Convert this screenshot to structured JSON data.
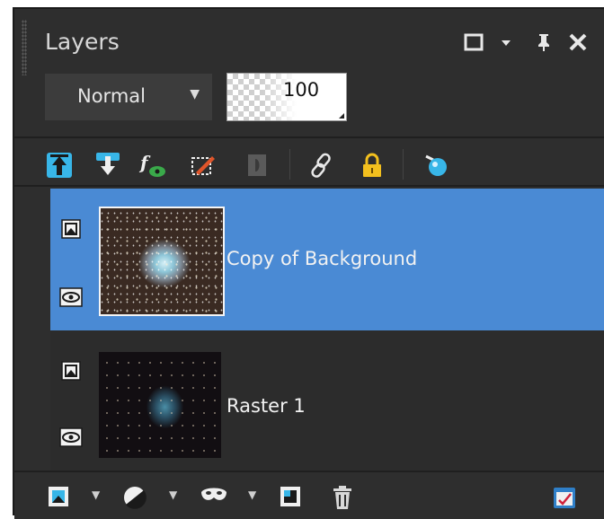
{
  "panel": {
    "title": "Layers",
    "window_buttons": [
      "maximize-icon",
      "menu-chevron-icon",
      "pin-icon",
      "close-icon"
    ]
  },
  "blend": {
    "mode": "Normal"
  },
  "opacity": {
    "value": "100"
  },
  "toolbar": {
    "icons": [
      "move-layer-up-icon",
      "move-layer-down-icon",
      "layer-style-effects-icon",
      "edit-selection-icon",
      "disabled-mask-icon",
      "link-icon",
      "lock-icon",
      "view-palette-icon"
    ]
  },
  "layers": [
    {
      "name": "Copy of Background",
      "selected": true,
      "visible": true
    },
    {
      "name": "Raster 1",
      "selected": false,
      "visible": true
    }
  ],
  "bottombar": {
    "icons": [
      "new-raster-layer-icon",
      "new-adjustment-layer-icon",
      "new-mask-icon",
      "merge-layers-icon",
      "delete-layer-icon",
      "layer-properties-icon"
    ]
  },
  "colors": {
    "selection": "#4a8ad4",
    "panel_bg": "#2e2e2e",
    "accent_cyan": "#38b6e8",
    "lock_yellow": "#f3c01e"
  }
}
